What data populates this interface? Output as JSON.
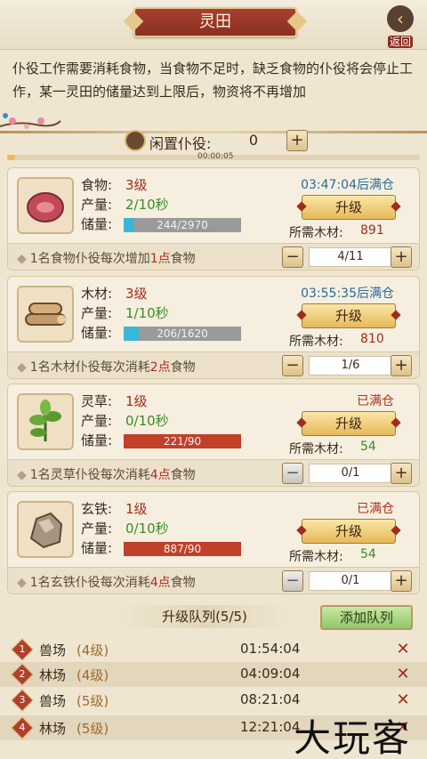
{
  "header": {
    "title": "灵田",
    "back_label": "返回",
    "back_icon": "back-arrow-icon"
  },
  "description": "仆役工作需要消耗食物，当食物不足时，缺乏食物的仆役将会停止工作，某一灵田的储量达到上限后，物资将不再增加",
  "idle": {
    "label": "闲置仆役:",
    "value": "0",
    "plus": "+",
    "timer": "00:00:05",
    "timer_progress": 0.02
  },
  "resources": [
    {
      "name": "食物:",
      "level": "3级",
      "prod_label": "产量:",
      "prod": "2/10秒",
      "stor_label": "储量:",
      "stor": "244/2970",
      "stor_fraction": 0.082,
      "stor_color": "#3ab6d8",
      "status": "03:47:04后满仓",
      "status_color": "#2a6a9a",
      "upgrade": "升级",
      "wood_label": "所需木材:",
      "wood": "891",
      "wood_color": "#a02c1c",
      "hint_pre": "1名食物仆役每次增加",
      "hint_num": "1点",
      "hint_post": "食物",
      "count": "4/11",
      "minus_disabled": false,
      "icon": "meat-icon"
    },
    {
      "name": "木材:",
      "level": "3级",
      "prod_label": "产量:",
      "prod": "1/10秒",
      "stor_label": "储量:",
      "stor": "206/1620",
      "stor_fraction": 0.127,
      "stor_color": "#3ab6d8",
      "status": "03:55:35后满仓",
      "status_color": "#2a6a9a",
      "upgrade": "升级",
      "wood_label": "所需木材:",
      "wood": "810",
      "wood_color": "#a02c1c",
      "hint_pre": "1名木材仆役每次消耗",
      "hint_num": "2点",
      "hint_post": "食物",
      "count": "1/6",
      "minus_disabled": false,
      "icon": "logs-icon"
    },
    {
      "name": "灵草:",
      "level": "1级",
      "prod_label": "产量:",
      "prod": "0/10秒",
      "stor_label": "储量:",
      "stor": "221/90",
      "stor_fraction": 1,
      "stor_color": "#c0402a",
      "status": "已满仓",
      "status_color": "#b0301e",
      "upgrade": "升级",
      "wood_label": "所需木材:",
      "wood": "54",
      "wood_color": "#3a8a2a",
      "hint_pre": "1名灵草仆役每次消耗",
      "hint_num": "4点",
      "hint_post": "食物",
      "count": "0/1",
      "minus_disabled": true,
      "icon": "herb-icon"
    },
    {
      "name": "玄铁:",
      "level": "1级",
      "prod_label": "产量:",
      "prod": "0/10秒",
      "stor_label": "储量:",
      "stor": "887/90",
      "stor_fraction": 1,
      "stor_color": "#c0402a",
      "status": "已满仓",
      "status_color": "#b0301e",
      "upgrade": "升级",
      "wood_label": "所需木材:",
      "wood": "54",
      "wood_color": "#3a8a2a",
      "hint_pre": "1名玄铁仆役每次消耗",
      "hint_num": "4点",
      "hint_post": "食物",
      "count": "0/1",
      "minus_disabled": true,
      "icon": "ore-icon"
    }
  ],
  "queue": {
    "title": "升级队列(5/5)",
    "add_label": "添加队列",
    "items": [
      {
        "idx": "1",
        "name": "兽场",
        "level": "(4级)",
        "time": "01:54:04"
      },
      {
        "idx": "2",
        "name": "林场",
        "level": "(4级)",
        "time": "04:09:04"
      },
      {
        "idx": "3",
        "name": "兽场",
        "level": "(5级)",
        "time": "08:21:04"
      },
      {
        "idx": "4",
        "name": "林场",
        "level": "(5级)",
        "time": "12:21:04"
      }
    ],
    "cancel_icon": "cancel-x-icon"
  },
  "watermark": "大玩客"
}
